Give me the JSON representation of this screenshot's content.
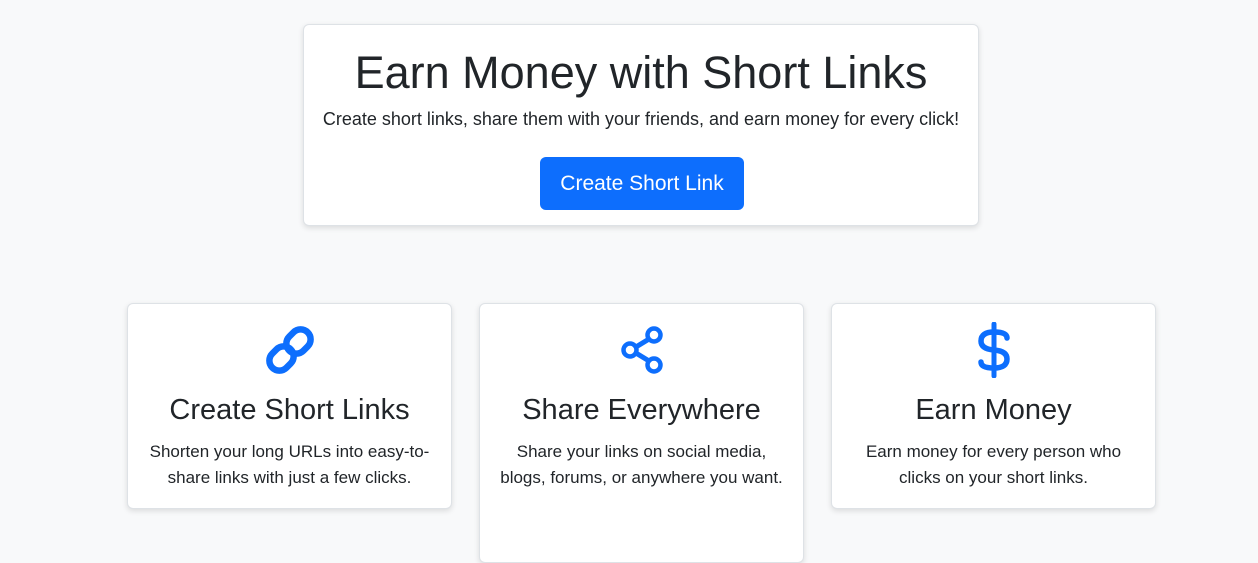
{
  "hero": {
    "title": "Earn Money with Short Links",
    "subtitle": "Create short links, share them with your friends, and earn money for every click!",
    "cta_label": "Create Short Link"
  },
  "features": [
    {
      "icon": "link-icon",
      "title": "Create Short Links",
      "description": "Shorten your long URLs into easy-to-share links with just a few clicks."
    },
    {
      "icon": "share-icon",
      "title": "Share Everywhere",
      "description": "Share your links on social media, blogs, forums, or anywhere you want."
    },
    {
      "icon": "dollar-icon",
      "title": "Earn Money",
      "description": "Earn money for every person who clicks on your short links."
    }
  ],
  "colors": {
    "accent": "#0d6efd",
    "background": "#f8f9fa",
    "card": "#ffffff",
    "text": "#212529"
  }
}
